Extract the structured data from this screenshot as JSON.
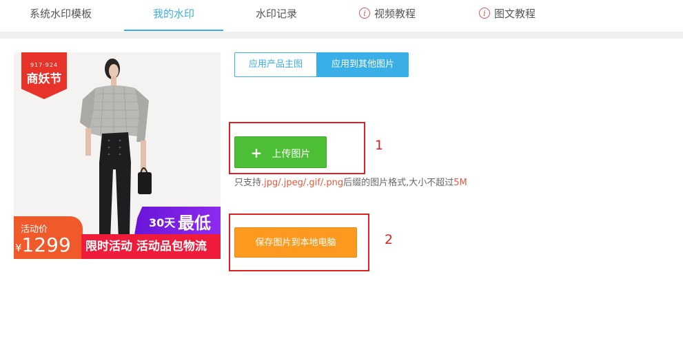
{
  "tabs": [
    {
      "label": "系统水印模板",
      "active": false,
      "icon": null
    },
    {
      "label": "我的水印",
      "active": true,
      "icon": null
    },
    {
      "label": "水印记录",
      "active": false,
      "icon": null
    },
    {
      "label": "视频教程",
      "active": false,
      "icon": "info-icon"
    },
    {
      "label": "图文教程",
      "active": false,
      "icon": "info-icon"
    }
  ],
  "info_glyph": "i",
  "product": {
    "badge_top": "917·924",
    "badge_main": "商妖节",
    "promo_days": "30天",
    "promo_low": "最低价",
    "price_label": "活动价",
    "currency": "¥",
    "price": "1299",
    "promo_text": "限时活动 活动品包物流"
  },
  "toggle": {
    "option1": "应用产品主图",
    "option2": "应用到其他图片",
    "active": "option2"
  },
  "upload": {
    "plus": "+",
    "label": "上传图片"
  },
  "hint": {
    "prefix": "只支持",
    "formats": ".jpg/.jpeg/.gif/.png",
    "middle": "后缀的图片格式,大小不超过",
    "size": "5M"
  },
  "save": {
    "label": "保存图片到本地电脑"
  },
  "annotations": {
    "one": "1",
    "two": "2"
  },
  "colors": {
    "accent": "#3aaee6",
    "upload_green": "#4cbf36",
    "save_orange": "#fb9a1e",
    "annotation_red": "#e02020"
  }
}
